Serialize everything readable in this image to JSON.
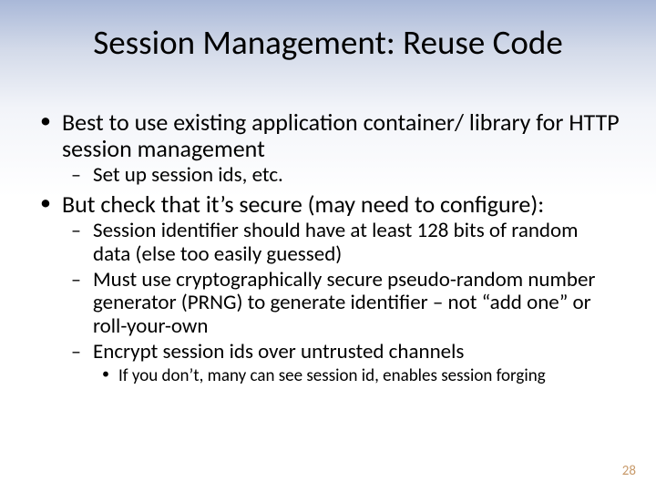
{
  "slide": {
    "title": "Session Management: Reuse Code",
    "page_number": "28",
    "bullets": [
      {
        "text": "Best to use existing application container/ library for HTTP session management",
        "children": [
          {
            "text": "Set up session ids, etc."
          }
        ]
      },
      {
        "text": "But check that it’s secure (may need to configure):",
        "children": [
          {
            "text": "Session identifier should have at least 128 bits of random data (else too easily guessed)"
          },
          {
            "text": "Must use cryptographically secure pseudo-random number generator (PRNG) to generate identifier – not “add one” or roll-your-own"
          },
          {
            "text": "Encrypt session ids over untrusted channels",
            "children": [
              {
                "text": "If you don’t, many can see session id, enables session forging"
              }
            ]
          }
        ]
      }
    ]
  }
}
